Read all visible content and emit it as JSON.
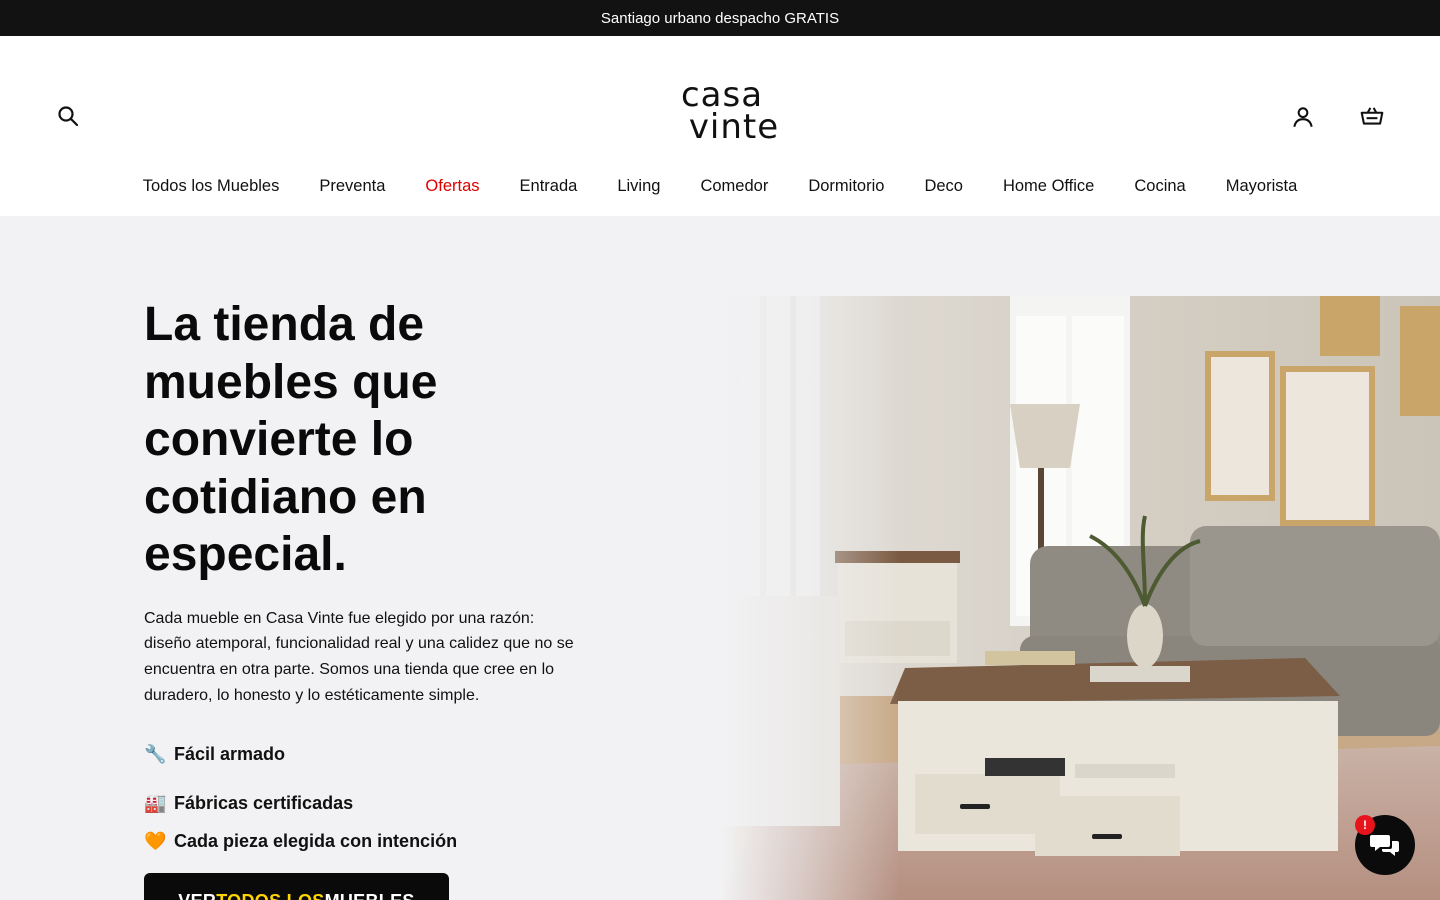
{
  "announcement": {
    "text": "Santiago urbano despacho GRATIS"
  },
  "header": {
    "logo": {
      "line1": "casa",
      "line2": "vinte"
    },
    "icons": {
      "search": "search-icon",
      "account": "user-icon",
      "cart": "basket-icon"
    }
  },
  "nav": {
    "items": [
      {
        "label": "Todos los Muebles"
      },
      {
        "label": "Preventa"
      },
      {
        "label": "Ofertas",
        "color": "#e00000"
      },
      {
        "label": "Entrada"
      },
      {
        "label": "Living"
      },
      {
        "label": "Comedor"
      },
      {
        "label": "Dormitorio"
      },
      {
        "label": "Deco"
      },
      {
        "label": "Home Office"
      },
      {
        "label": "Cocina"
      },
      {
        "label": "Mayorista"
      }
    ]
  },
  "hero": {
    "title": "La tienda de muebles que convierte lo cotidiano en especial.",
    "description": "Cada mueble en Casa Vinte fue elegido por una razón: diseño atemporal, funcionalidad real y una calidez que no se encuentra en otra parte. Somos una tienda que cree en lo duradero, lo honesto y lo estéticamente simple.",
    "features": [
      {
        "emoji": "🔧",
        "text": "Fácil armado"
      },
      {
        "emoji": "🏭",
        "text": "Fábricas certificadas"
      },
      {
        "emoji": "🧡",
        "text": "Cada pieza elegida con intención"
      }
    ],
    "cta": {
      "part1": "VER ",
      "highlight": "TODOS LOS",
      "part2": " MUEBLES",
      "highlight_color": "#ffd400"
    },
    "image": {
      "alt": "living-room-photo"
    }
  },
  "chat": {
    "badge": "!",
    "icon": "chat-bubbles-icon"
  },
  "colors": {
    "announcement_bg": "#121212",
    "hero_bg": "#f2f2f4",
    "sale": "#e00000",
    "badge": "#e8141b"
  }
}
